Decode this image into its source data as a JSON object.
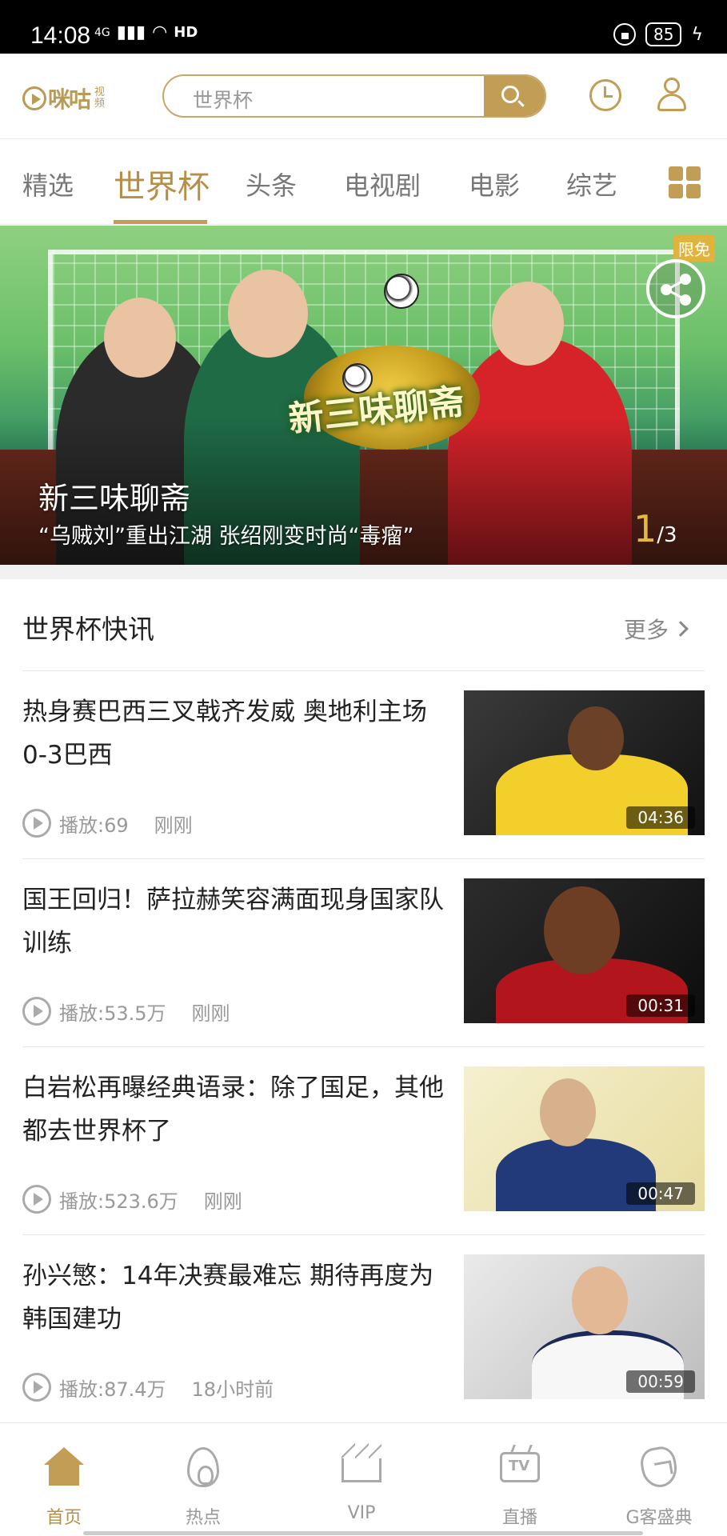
{
  "status_bar": {
    "time": "14:08",
    "signal": "4G",
    "network": "HD",
    "battery": "85"
  },
  "header": {
    "logo_text": "咪咕",
    "logo_sub": "视频",
    "search_placeholder": "世界杯",
    "accent_color": "#c29d55"
  },
  "tabs": [
    {
      "label": "精选",
      "active": false
    },
    {
      "label": "世界杯",
      "active": true
    },
    {
      "label": "头条",
      "active": false
    },
    {
      "label": "电视剧",
      "active": false
    },
    {
      "label": "电影",
      "active": false
    },
    {
      "label": "综艺",
      "active": false
    }
  ],
  "banner": {
    "badge": "限免",
    "title": "新三味聊斋",
    "subtitle": "“乌贼刘”重出江湖 张绍刚变时尚“毒瘤”",
    "page_current": "1",
    "page_total": "/3",
    "logo_text": "新三味聊斋"
  },
  "section": {
    "title": "世界杯快讯",
    "more_label": "更多"
  },
  "news": [
    {
      "title": "热身赛巴西三叉戟齐发威 奥地利主场0-3巴西",
      "plays": "播放:69",
      "time": "刚刚",
      "duration": "04:36"
    },
    {
      "title": "国王回归！萨拉赫笑容满面现身国家队训练",
      "plays": "播放:53.5万",
      "time": "刚刚",
      "duration": "00:31"
    },
    {
      "title": "白岩松再曝经典语录：除了国足，其他都去世界杯了",
      "plays": "播放:523.6万",
      "time": "刚刚",
      "duration": "00:47"
    },
    {
      "title": "孙兴慜：14年决赛最难忘 期待再度为韩国建功",
      "plays": "播放:87.4万",
      "time": "18小时前",
      "duration": "00:59"
    }
  ],
  "bottom_nav": [
    {
      "label": "首页",
      "icon": "home-icon",
      "active": true
    },
    {
      "label": "热点",
      "icon": "flame-icon",
      "active": false
    },
    {
      "label": "VIP",
      "icon": "crown-icon",
      "active": false
    },
    {
      "label": "直播",
      "icon": "tv-icon",
      "active": false
    },
    {
      "label": "G客盛典",
      "icon": "g-icon",
      "active": false
    }
  ]
}
